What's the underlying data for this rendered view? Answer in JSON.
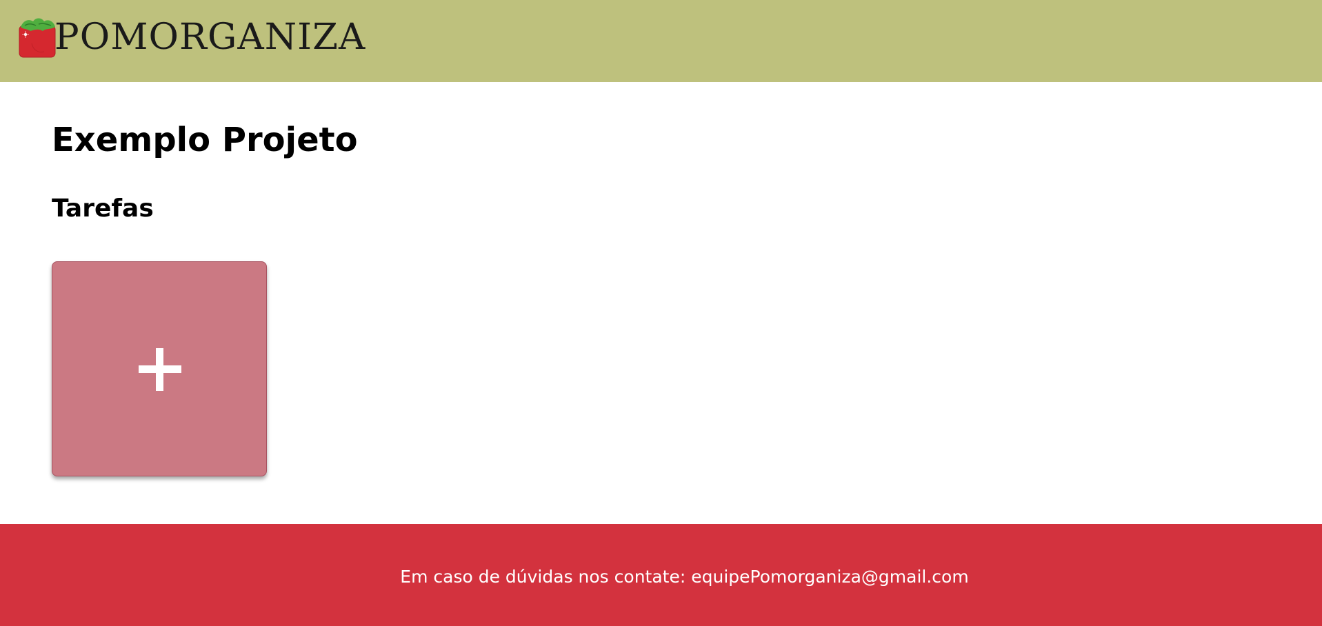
{
  "header": {
    "logo_text": "POMORGANIZA",
    "logo_icon": "tomato-logo-icon",
    "background_color": "#bec17d"
  },
  "main": {
    "project_title": "Exemplo Projeto",
    "tasks_heading": "Tarefas",
    "add_task_card": {
      "icon": "plus-icon",
      "card_color": "#cb7983"
    }
  },
  "footer": {
    "contact_prefix": "Em caso de dúvidas nos contate:",
    "contact_email": "equipePomorganiza@gmail.com",
    "background_color": "#d3323e"
  }
}
